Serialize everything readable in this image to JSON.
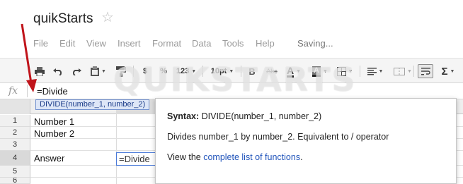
{
  "doc_title": "quikStarts",
  "menu": [
    "File",
    "Edit",
    "View",
    "Insert",
    "Format",
    "Data",
    "Tools",
    "Help"
  ],
  "status": "Saving...",
  "toolbar": {
    "currency": "$",
    "percent": "%",
    "number_format": "123",
    "font_size": "10pt",
    "bold": "B",
    "strike": "Abc",
    "text_color": "A",
    "fill_color": "A",
    "sum": "Σ"
  },
  "formula_bar": {
    "fx_label": "fx",
    "value": "=Divide"
  },
  "autocomplete_hint": "DIVIDE(number_1, number_2)",
  "row_numbers": [
    "1",
    "2",
    "3",
    "4",
    "5",
    "6"
  ],
  "cells": {
    "a1": "Number 1",
    "a2": "Number 2",
    "a4": "Answer",
    "b4": "=Divide"
  },
  "help_popup": {
    "syntax_label": "Syntax:",
    "syntax_value": "DIVIDE(number_1, number_2)",
    "description": "Divides number_1 by number_2. Equivalent to / operator",
    "view_prefix": "View the",
    "link_text": "complete list of functions",
    "view_suffix": "."
  },
  "watermark": "QUIKSTARTS",
  "colors": {
    "arrow": "#c0141b",
    "link": "#2255bb",
    "hint_bg": "#dde6f7",
    "selection_border": "#4a7ad9"
  }
}
